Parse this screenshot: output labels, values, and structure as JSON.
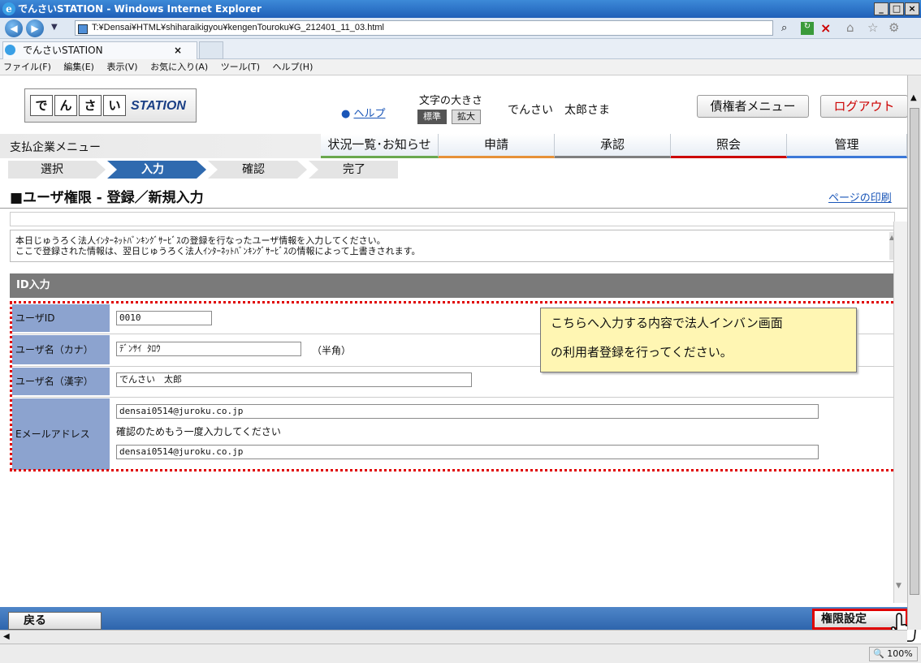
{
  "window": {
    "title": "でんさいSTATION - Windows Internet Explorer",
    "url": "T:¥Densai¥HTML¥shiharaikigyou¥kengenTouroku¥G_212401_11_03.html",
    "tab_title": "でんさいSTATION"
  },
  "menu": [
    "ファイル(F)",
    "編集(E)",
    "表示(V)",
    "お気に入り(A)",
    "ツール(T)",
    "ヘルプ(H)"
  ],
  "header": {
    "logo_chars": [
      "で",
      "ん",
      "さ",
      "い"
    ],
    "logo_text": "STATION",
    "help_link": "ヘルプ",
    "font_size_label": "文字の大きさ",
    "font_standard": "標準",
    "font_large": "拡大",
    "user_name": "でんさい　太郎さま",
    "creditor_menu": "債権者メニュー",
    "logout": "ログアウト"
  },
  "nav": {
    "menu_title": "支払企業メニュー",
    "tabs": [
      "状況一覧･お知らせ",
      "申請",
      "承認",
      "照会",
      "管理"
    ],
    "tab_colors": [
      "#6aa84f",
      "#e69138",
      "#7f7f7f",
      "#cc0000",
      "#3c78d8"
    ]
  },
  "steps": [
    "選択",
    "入力",
    "確認",
    "完了"
  ],
  "page": {
    "title": "■ユーザ権限 - 登録／新規入力",
    "print_link": "ページの印刷",
    "instruction_line1": "本日じゅうろく法人ｲﾝﾀｰﾈｯﾄﾊﾞﾝｷﾝｸﾞｻｰﾋﾞｽの登録を行なったユーザ情報を入力してください。",
    "instruction_line2": "ここで登録された情報は、翌日じゅうろく法人ｲﾝﾀｰﾈｯﾄﾊﾞﾝｷﾝｸﾞｻｰﾋﾞｽの情報によって上書きされます。",
    "section_title": "ID入力"
  },
  "form": {
    "user_id_label": "ユーザID",
    "user_id_value": "0010",
    "kana_label": "ユーザ名（カナ）",
    "kana_value": "ﾃﾞﾝｻｲ ﾀﾛｳ",
    "kana_note": "（半角）",
    "kanji_label": "ユーザ名（漢字）",
    "kanji_value": "でんさい　太郎",
    "email_label": "Eメールアドレス",
    "email_value": "densai0514@juroku.co.jp",
    "email_confirm_note": "確認のためもう一度入力してください",
    "email_confirm_value": "densai0514@juroku.co.jp"
  },
  "callout": {
    "line1": "こちらへ入力する内容で法人インバン画面",
    "line2": "の利用者登録を行ってください。"
  },
  "footer": {
    "back": "戻る",
    "permission": "権限設定"
  },
  "status": {
    "zoom": "100%"
  }
}
